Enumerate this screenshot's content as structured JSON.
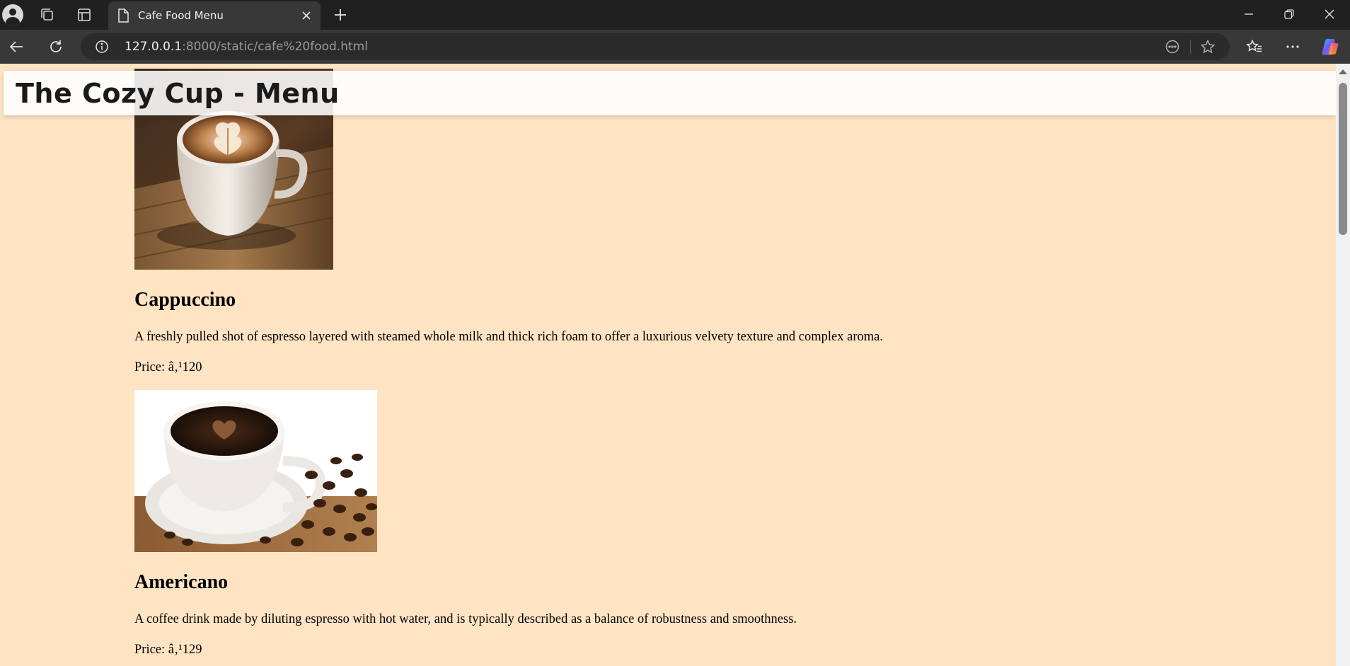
{
  "browser": {
    "tab": {
      "title": "Cafe Food Menu"
    },
    "address": {
      "host": "127.0.0.1",
      "path": ":8000/static/cafe%20food.html"
    }
  },
  "page": {
    "header": {
      "title": "The Cozy Cup - Menu"
    },
    "items": [
      {
        "name": "Cappuccino",
        "description": "A freshly pulled shot of espresso layered with steamed whole milk and thick rich foam to offer a luxurious velvety texture and complex aroma.",
        "price": "Price: â‚¹120"
      },
      {
        "name": "Americano",
        "description": "A coffee drink made by diluting espresso with hot water, and is typically described as a balance of robustness and smoothness.",
        "price": "Price: â‚¹129"
      }
    ]
  },
  "colors": {
    "page_background": "#ffe4c4",
    "chrome_dark": "#202020",
    "toolbar": "#383838"
  },
  "icons": [
    "profile-icon",
    "collections-icon",
    "tab-actions-icon",
    "document-icon",
    "close-icon",
    "plus-icon",
    "minimize-icon",
    "restore-icon",
    "window-close-icon",
    "back-icon",
    "reload-icon",
    "info-icon",
    "reader-icon",
    "star-icon",
    "favorites-icon",
    "more-icon",
    "copilot-icon"
  ]
}
